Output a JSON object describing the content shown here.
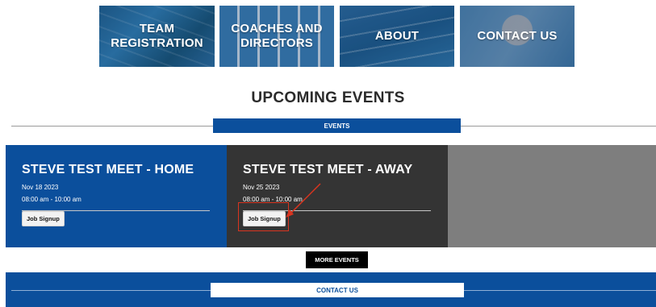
{
  "nav_tiles": [
    {
      "label": "TEAM REGISTRATION"
    },
    {
      "label": "COACHES AND DIRECTORS"
    },
    {
      "label": "ABOUT"
    },
    {
      "label": "CONTACT US"
    }
  ],
  "upcoming": {
    "heading": "UPCOMING EVENTS",
    "tab_label": "EVENTS"
  },
  "events": [
    {
      "title": "STEVE TEST MEET - HOME",
      "date": "Nov 18 2023",
      "time": "08:00 am  -  10:00 am",
      "button": "Job Signup"
    },
    {
      "title": "STEVE TEST MEET - AWAY",
      "date": "Nov 25 2023",
      "time": "08:00 am  -  10:00 am",
      "button": "Job Signup"
    }
  ],
  "more_events_label": "MORE EVENTS",
  "contact_label": "CONTACT US",
  "colors": {
    "brand_blue": "#0b4f9c",
    "dark_card": "#343434",
    "gray_card": "#7e7e7e",
    "annotation_red": "#d9341f"
  }
}
